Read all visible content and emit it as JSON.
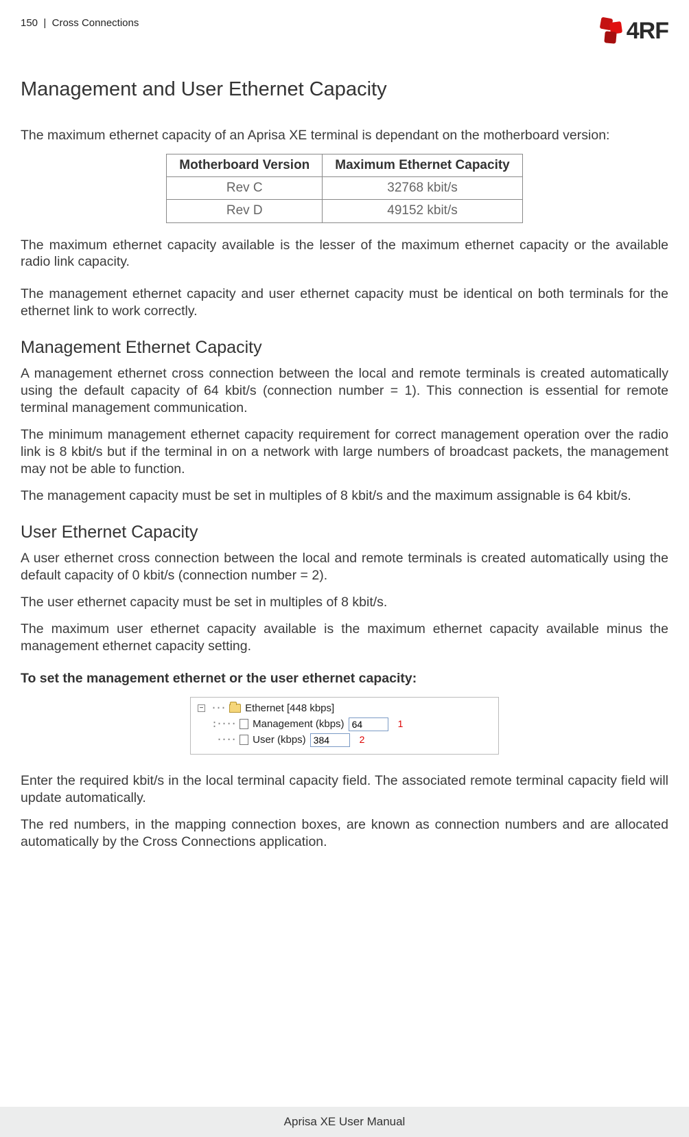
{
  "header": {
    "page_num": "150",
    "separator": "|",
    "section": "Cross Connections",
    "brand": "4RF"
  },
  "title": "Management and User Ethernet Capacity",
  "intro": "The maximum ethernet capacity of an Aprisa XE terminal is dependant on the motherboard version:",
  "table": {
    "h1": "Motherboard Version",
    "h2": "Maximum Ethernet Capacity",
    "r1c1": "Rev C",
    "r1c2": "32768 kbit/s",
    "r2c1": "Rev D",
    "r2c2": "49152 kbit/s"
  },
  "p2": "The maximum ethernet capacity available is the lesser of the maximum ethernet capacity or the available radio link capacity.",
  "p3": "The management ethernet capacity and user ethernet capacity must be identical on both terminals for the ethernet link to work correctly.",
  "sec1_title": "Management Ethernet Capacity",
  "sec1_p1": "A management ethernet cross connection between the local and remote terminals is created automatically using the default capacity of 64 kbit/s  (connection number = 1). This connection is essential for remote terminal management communication.",
  "sec1_p2": "The minimum management ethernet capacity requirement for correct management operation over the radio link is 8 kbit/s but if the terminal in on a network with large numbers of broadcast packets, the management may not be able to function.",
  "sec1_p3": "The management capacity must be set in multiples of 8 kbit/s and the maximum assignable is 64 kbit/s.",
  "sec2_title": "User Ethernet Capacity",
  "sec2_p1": "A user ethernet cross connection between the local and remote terminals is created automatically using the default capacity of 0 kbit/s (connection number = 2).",
  "sec2_p2": "The user ethernet capacity must be set in multiples of 8 kbit/s.",
  "sec2_p3": "The maximum user ethernet capacity available is the maximum ethernet capacity available minus the management ethernet capacity setting.",
  "howto_title": "To set the management ethernet or the user ethernet capacity:",
  "ui": {
    "root_label": "Ethernet [448 kbps]",
    "mgmt_label": "Management (kbps)",
    "mgmt_value": "64",
    "mgmt_num": "1",
    "user_label": "User (kbps)",
    "user_value": "384",
    "user_num": "2"
  },
  "after1": "Enter the required kbit/s in the local terminal capacity field. The associated remote terminal capacity field will update automatically.",
  "after2": "The red numbers, in the mapping connection boxes, are known as connection numbers and are allocated automatically by the Cross Connections application.",
  "footer": "Aprisa XE User Manual"
}
